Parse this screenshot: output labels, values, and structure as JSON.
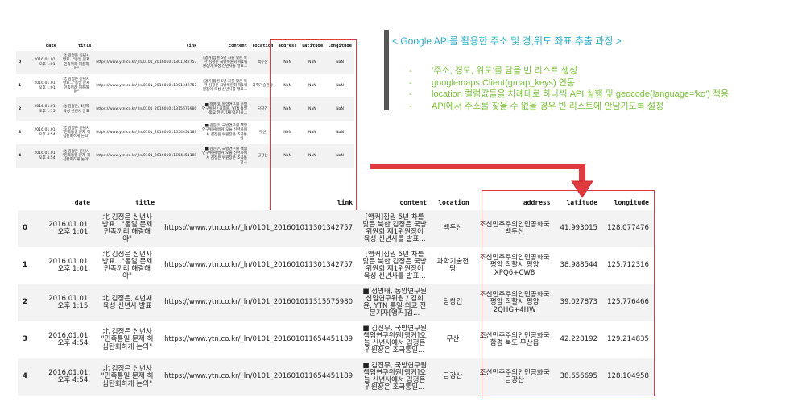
{
  "colors": {
    "title_cyan": "#2eb1c8",
    "step_green": "#7bc23a",
    "highlight_red": "#e0393e",
    "arrow_red": "#e0393e",
    "bar_gray": "#555555"
  },
  "top_table": {
    "columns": [
      "",
      "date",
      "title",
      "link",
      "content",
      "location",
      "address",
      "latitude",
      "longitude"
    ],
    "rows": [
      [
        "0",
        "2016.01.01. 오후 1:01.",
        "北 김정은 신년사 방표...\"동일 문제 민족끼리 해결해야\"",
        "https://www.ytn.co.kr/_ln/0101_201601011301342757",
        "[앵커]집권 5년 차를 맞은 북한 김정은 국방위원회 제1위원장이 육성 신년사를 발표...",
        "백두산",
        "NaN",
        "NaN",
        "NaN"
      ],
      [
        "1",
        "2016.01.01. 오후 1:01.",
        "北 김정은 신년사 방표...\"동일 문제 민족끼리 해결해야\"",
        "https://www.ytn.co.kr/_ln/0101_201601011301342757",
        "[앵커]집권 5년 차를 맞은 북한 김정은 국방위원회 제1위원장이 육성 신년사를 발표...",
        "과학기술전당",
        "NaN",
        "NaN",
        "NaN"
      ],
      [
        "2",
        "2016.01.01. 오후 1:15.",
        "北 김정은, 4년째 육성 신년사 발표",
        "https://www.ytn.co.kr/_ln/0101_201601011315575980",
        "■ 정영태, 동양연구원 선임연구위원 / 김희윤, YTN 통일·외교 전문기자[앵커]김...",
        "당창건",
        "NaN",
        "NaN",
        "NaN"
      ],
      [
        "3",
        "2016.01.01. 오후 4:54.",
        "北 김정은 신년사 \"민족통일 문제 허심탄회하게 논의\"",
        "https://www.ytn.co.kr/_ln/0101_201601011654451189",
        "■ 김진무, 국방연구원 책임연구위원[앵커]오늘 신년사에서 김정은 위원장은 조국통일...",
        "무산",
        "NaN",
        "NaN",
        "NaN"
      ],
      [
        "4",
        "2016.01.01. 오후 4:54.",
        "北 김정은 신년사 \"민족통일 문제 허심탄회하게 논의\"",
        "https://www.ytn.co.kr/_ln/0101_201601011654451189",
        "■ 김진무, 국방연구원 책임연구위원[앵커]오늘 신년사에서 김정은 위원장은 조국통일...",
        "금강산",
        "NaN",
        "NaN",
        "NaN"
      ]
    ]
  },
  "panel": {
    "title": "< Google API를 활용한 주소 및 경,위도 좌표 추출 과정 >",
    "bullet": "-",
    "steps": [
      "‘주소, 경도, 위도’를 담을 빈 리스트 생성",
      "googlemaps.Client(gmap_keys) 연동",
      "location 컬럼값들을 차례대로 하나씩 API 실행 및 geocode(language='ko') 적용",
      "API에서 주소를 찾을 수 없을 경우 빈 리스트에 안담기도록 설정"
    ]
  },
  "bottom_table": {
    "columns": [
      "",
      "date",
      "title",
      "link",
      "content",
      "location",
      "address",
      "latitude",
      "longitude"
    ],
    "rows": [
      [
        "0",
        "2016.01.01. 오후 1:01.",
        "北 김정은 신년사 방표...\"동일 문제 민족끼리 해결해야\"",
        "https://www.ytn.co.kr/_ln/0101_201601011301342757",
        "[앵커]집권 5년 차를 맞은 북한 김정은 국방위원회 제1위원장이 육성 신년사를 발표...",
        "백두산",
        "조선민주주의인민공화국 백두산",
        "41.993015",
        "128.077476"
      ],
      [
        "1",
        "2016.01.01. 오후 1:01.",
        "北 김정은 신년사 방표...\"동일 문제 민족끼리 해결해야\"",
        "https://www.ytn.co.kr/_ln/0101_201601011301342757",
        "[앵커]집권 5년 차를 맞은 북한 김정은 국방위원회 제1위원장이 육성 신년사를 발표...",
        "과학기술전당",
        "조선민주주의인민공화국 평양 직할시 평양 XPQ6+CW8",
        "38.988544",
        "125.712316"
      ],
      [
        "2",
        "2016.01.01. 오후 1:15.",
        "北 김정은, 4년째 육성 신년사 발표",
        "https://www.ytn.co.kr/_ln/0101_201601011315575980",
        "■ 정영태, 동양연구원 선임연구위원 / 김희윤, YTN 통일·외교 전문기자[앵커]김...",
        "당창건",
        "조선민주주의인민공화국 평양 직할시 평양 2QHG+4HW",
        "39.027873",
        "125.776466"
      ],
      [
        "3",
        "2016.01.01. 오후 4:54.",
        "北 김정은 신년사 \"민족통일 문제 허심탄회하게 논의\"",
        "https://www.ytn.co.kr/_ln/0101_201601011654451189",
        "■ 김진무, 국방연구원 책임연구위원[앵커]오늘 신년사에서 김정은 위원장은 조국통일...",
        "무산",
        "조선민주주의인민공화국 함경 북도 무산읍",
        "42.228192",
        "129.214835"
      ],
      [
        "4",
        "2016.01.01. 오후 4:54.",
        "北 김정은 신년사 \"민족통일 문제 허심탄회하게 논의\"",
        "https://www.ytn.co.kr/_ln/0101_201601011654451189",
        "■ 김진무, 국방연구원 책임연구위원[앵커]오늘 신년사에서 김정은 위원장은 조국통일...",
        "금강산",
        "조선민주주의인민공화국 금강산",
        "38.656695",
        "128.104958"
      ]
    ]
  }
}
